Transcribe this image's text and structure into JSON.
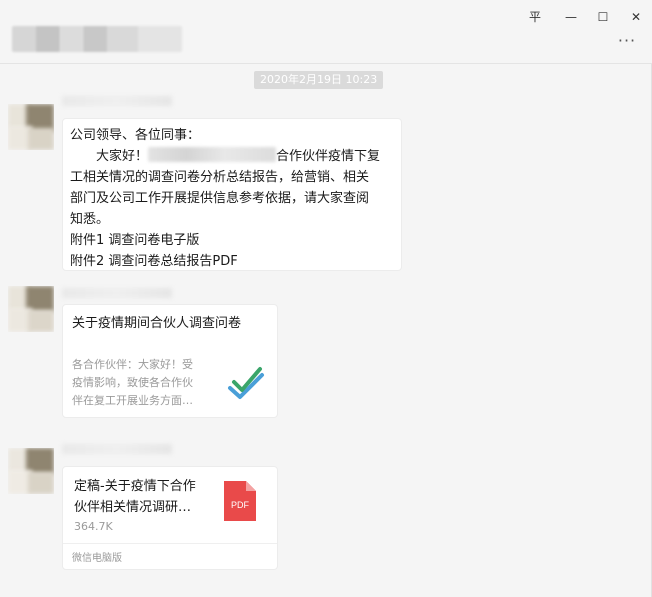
{
  "window": {
    "controls": {
      "pin": "平",
      "minimize": "—",
      "maximize": "☐",
      "close": "✕"
    },
    "more_label": "···"
  },
  "chat": {
    "timestamp": "2020年2月19日 10:23",
    "message1": {
      "line1": "公司领导、各位同事：",
      "line2_prefix": "大家好！",
      "line2_suffix": "合作伙伴疫情下复",
      "line3": "工相关情况的调查问卷分析总结报告，给营销、相关",
      "line4": "部门及公司工作开展提供信息参考依据，请大家查阅",
      "line5": "知悉。",
      "line6": "附件1 调查问卷电子版",
      "line7": "附件2 调查问卷总结报告PDF"
    },
    "link_card": {
      "title": "关于疫情期间合伙人调查问卷",
      "desc_line1": "各合作伙伴：大家好！受",
      "desc_line2": "疫情影响，致使各合作伙",
      "desc_line3": "伴在复工开展业务方面…",
      "icon": "check-icon"
    },
    "file_card": {
      "name_line1": "定稿-关于疫情下合作",
      "name_line2": "伙伴相关情况调研…",
      "size": "364.7K",
      "file_type": "PDF",
      "footer": "微信电脑版",
      "icon": "pdf-file-icon",
      "icon_color": "#e94a4a"
    }
  }
}
